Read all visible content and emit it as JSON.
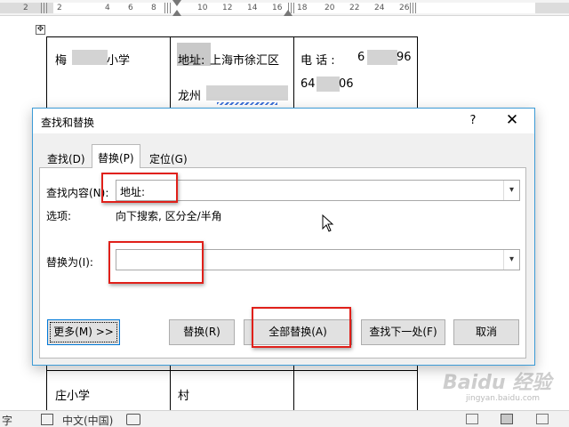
{
  "ruler": {
    "ticks": [
      "2",
      "2",
      "4",
      "6",
      "8",
      "10",
      "12",
      "14",
      "16",
      "18",
      "20",
      "22",
      "24",
      "26"
    ]
  },
  "document": {
    "row1": {
      "school_prefix": "梅",
      "school_suffix": "小学",
      "address_label": "地址:",
      "address_value": "上海市徐汇区",
      "address_line2": "龙州",
      "phone_label": "电  话 :",
      "phone_part1": "6",
      "phone_part1_end": "96",
      "phone_part2": "64",
      "phone_part2_end": "06"
    },
    "row2": {
      "school": "庄小学",
      "village": "村"
    }
  },
  "dialog": {
    "title": "查找和替换",
    "help": "?",
    "close": "✕",
    "tabs": [
      {
        "label": "查找(D)"
      },
      {
        "label": "替换(P)"
      },
      {
        "label": "定位(G)"
      }
    ],
    "find_label": "查找内容(N):",
    "find_value": "地址:",
    "options_label": "选项:",
    "options_value": "向下搜索, 区分全/半角",
    "replace_label": "替换为(I):",
    "replace_value": "",
    "buttons": {
      "more": "更多(M) >>",
      "replace": "替换(R)",
      "replace_all": "全部替换(A)",
      "find_next": "查找下一处(F)",
      "cancel": "取消"
    },
    "accent_color": "#0078d7",
    "highlight_color": "#e0201a"
  },
  "statusbar": {
    "words": "字",
    "language": "中文(中国)"
  },
  "watermark": {
    "brand": "Baidu 经验",
    "url": "jingyan.baidu.com"
  }
}
